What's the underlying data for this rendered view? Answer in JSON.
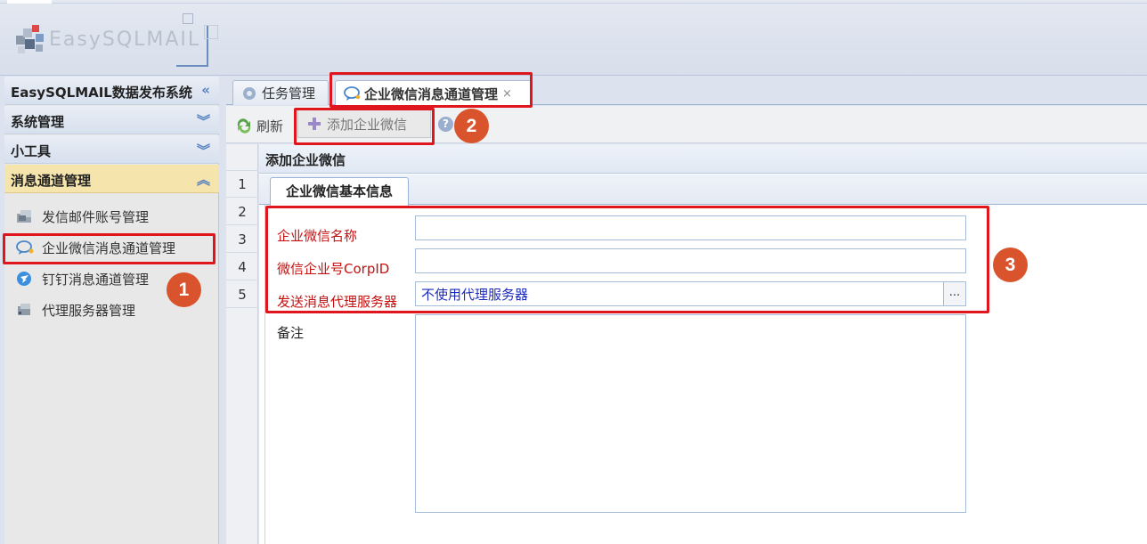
{
  "header": {
    "logo_text": "EasySQLMAIL"
  },
  "sidebar": {
    "title": "EasySQLMAIL数据发布系统",
    "title_icon": "double-chevron-left",
    "sections": [
      {
        "label": "系统管理",
        "icon": "double-chevron-down"
      },
      {
        "label": "小工具",
        "icon": "double-chevron-down"
      },
      {
        "label": "消息通道管理",
        "icon": "double-chevron-up",
        "active": true
      }
    ],
    "items": [
      {
        "label": "发信邮件账号管理",
        "icon": "mail-server-icon"
      },
      {
        "label": "企业微信消息通道管理",
        "icon": "chat-bubble-icon",
        "selected": true
      },
      {
        "label": "钉钉消息通道管理",
        "icon": "dingtalk-icon"
      },
      {
        "label": "代理服务器管理",
        "icon": "proxy-server-icon"
      }
    ]
  },
  "tabs": [
    {
      "label": "任务管理",
      "icon": "gear-icon"
    },
    {
      "label": "企业微信消息通道管理",
      "icon": "chat-bubble-icon",
      "active": true,
      "close": "×"
    }
  ],
  "toolbar": {
    "refresh_label": "刷新",
    "add_label": "添加企业微信",
    "help": "?"
  },
  "row_numbers": [
    "1",
    "2",
    "3",
    "4",
    "5"
  ],
  "panel": {
    "title": "添加企业微信",
    "subtab": "企业微信基本信息",
    "fields": {
      "name_label": "企业微信名称",
      "name_value": "",
      "corp_label": "微信企业号CorpID",
      "corp_value": "",
      "proxy_label": "发送消息代理服务器",
      "proxy_value": "不使用代理服务器",
      "proxy_button": "...",
      "note_label": "备注",
      "note_value": ""
    }
  },
  "annotations": {
    "badge_1": "1",
    "badge_2": "2",
    "badge_3": "3"
  },
  "colors": {
    "required_label": "#c81010",
    "annotation_red": "#e0161e",
    "badge": "#d9542c",
    "active_section": "#f5e5ad"
  }
}
